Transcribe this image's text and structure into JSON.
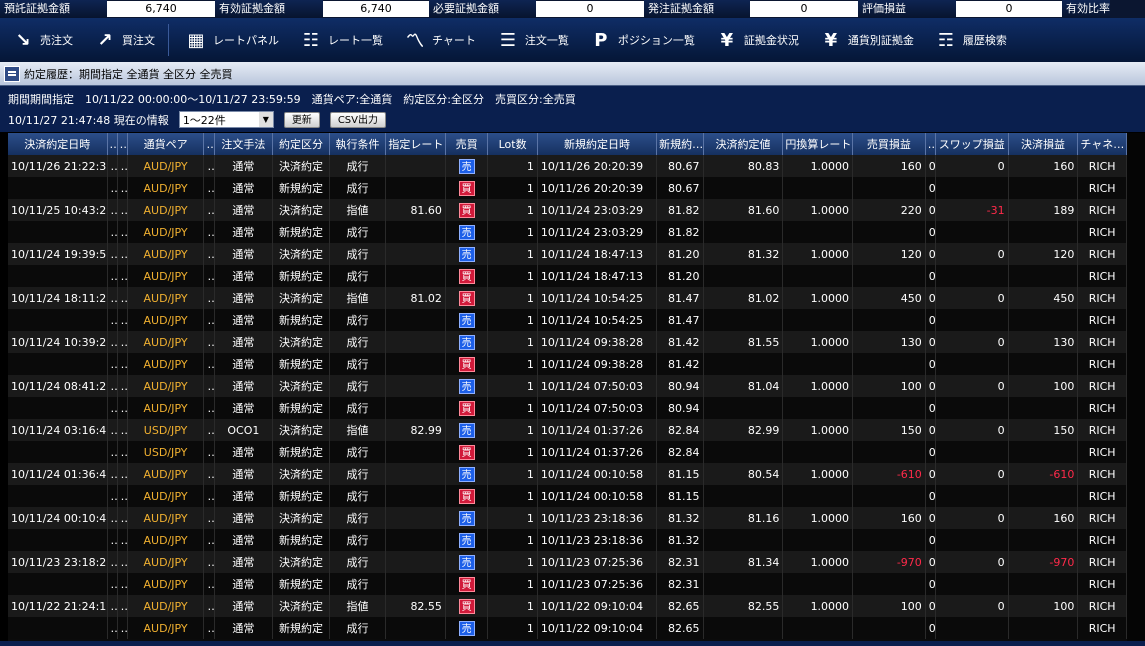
{
  "summary": [
    {
      "label": "預託証拠金額",
      "value": "6,740"
    },
    {
      "label": "有効証拠金額",
      "value": "6,740"
    },
    {
      "label": "必要証拠金額",
      "value": "0"
    },
    {
      "label": "発注証拠金額",
      "value": "0"
    },
    {
      "label": "評価損益",
      "value": "0"
    },
    {
      "label": "有効比率",
      "value": ""
    }
  ],
  "toolbar": [
    {
      "label": "売注文",
      "icon": "arrow-down-right-icon"
    },
    {
      "label": "買注文",
      "icon": "arrow-up-right-icon"
    },
    {
      "label": "レートパネル",
      "icon": "rate-panel-icon"
    },
    {
      "label": "レート一覧",
      "icon": "rate-list-icon"
    },
    {
      "label": "チャート",
      "icon": "chart-icon"
    },
    {
      "label": "注文一覧",
      "icon": "order-list-icon"
    },
    {
      "label": "ポジション一覧",
      "icon": "position-icon"
    },
    {
      "label": "証拠金状況",
      "icon": "yen-icon"
    },
    {
      "label": "通貨別証拠金",
      "icon": "currency-margin-icon"
    },
    {
      "label": "履歴検索",
      "icon": "history-search-icon"
    }
  ],
  "window": {
    "title": "約定履歴：期間指定 全通貨 全区分 全売買"
  },
  "filter": {
    "line1": "期間期間指定　10/11/22 00:00:00～10/11/27 23:59:59　通貨ペア:全通貨　約定区分:全区分　売買区分:全売買",
    "timestamp": "10/11/27 21:47:48 現在の情報",
    "range": "1～22件",
    "refresh_label": "更新",
    "csv_label": "CSV出力"
  },
  "table": {
    "headers": [
      "決済約定日時",
      "…",
      "…",
      "通貨ペア",
      "…",
      "注文手法",
      "約定区分",
      "執行条件",
      "指定レート",
      "売買",
      "Lot数",
      "新規約定日時",
      "新規約…",
      "決済約定値",
      "円換算レート",
      "売買損益",
      "…",
      "スワップ損益",
      "決済損益",
      "チャネ…"
    ],
    "rows": [
      [
        "10/11/26 21:22:3…",
        "…",
        "…",
        "AUD/JPY",
        "…",
        "通常",
        "決済約定",
        "成行",
        "",
        "売",
        "1",
        "10/11/26 20:20:39",
        "80.67",
        "80.83",
        "1.0000",
        "160",
        "0",
        "0",
        "160",
        "RICH"
      ],
      [
        "",
        "…",
        "…",
        "AUD/JPY",
        "…",
        "通常",
        "新規約定",
        "成行",
        "",
        "買",
        "1",
        "10/11/26 20:20:39",
        "80.67",
        "",
        "",
        "",
        "0",
        "",
        "",
        "RICH"
      ],
      [
        "10/11/25 10:43:2…",
        "…",
        "…",
        "AUD/JPY",
        "…",
        "通常",
        "決済約定",
        "指値",
        "81.60",
        "買",
        "1",
        "10/11/24 23:03:29",
        "81.82",
        "81.60",
        "1.0000",
        "220",
        "0",
        "-31",
        "189",
        "RICH"
      ],
      [
        "",
        "…",
        "…",
        "AUD/JPY",
        "…",
        "通常",
        "新規約定",
        "成行",
        "",
        "売",
        "1",
        "10/11/24 23:03:29",
        "81.82",
        "",
        "",
        "",
        "0",
        "",
        "",
        "RICH"
      ],
      [
        "10/11/24 19:39:5…",
        "…",
        "…",
        "AUD/JPY",
        "…",
        "通常",
        "決済約定",
        "成行",
        "",
        "売",
        "1",
        "10/11/24 18:47:13",
        "81.20",
        "81.32",
        "1.0000",
        "120",
        "0",
        "0",
        "120",
        "RICH"
      ],
      [
        "",
        "…",
        "…",
        "AUD/JPY",
        "…",
        "通常",
        "新規約定",
        "成行",
        "",
        "買",
        "1",
        "10/11/24 18:47:13",
        "81.20",
        "",
        "",
        "",
        "0",
        "",
        "",
        "RICH"
      ],
      [
        "10/11/24 18:11:2…",
        "…",
        "…",
        "AUD/JPY",
        "…",
        "通常",
        "決済約定",
        "指値",
        "81.02",
        "買",
        "1",
        "10/11/24 10:54:25",
        "81.47",
        "81.02",
        "1.0000",
        "450",
        "0",
        "0",
        "450",
        "RICH"
      ],
      [
        "",
        "…",
        "…",
        "AUD/JPY",
        "…",
        "通常",
        "新規約定",
        "成行",
        "",
        "売",
        "1",
        "10/11/24 10:54:25",
        "81.47",
        "",
        "",
        "",
        "0",
        "",
        "",
        "RICH"
      ],
      [
        "10/11/24 10:39:2…",
        "…",
        "…",
        "AUD/JPY",
        "…",
        "通常",
        "決済約定",
        "成行",
        "",
        "売",
        "1",
        "10/11/24 09:38:28",
        "81.42",
        "81.55",
        "1.0000",
        "130",
        "0",
        "0",
        "130",
        "RICH"
      ],
      [
        "",
        "…",
        "…",
        "AUD/JPY",
        "…",
        "通常",
        "新規約定",
        "成行",
        "",
        "買",
        "1",
        "10/11/24 09:38:28",
        "81.42",
        "",
        "",
        "",
        "0",
        "",
        "",
        "RICH"
      ],
      [
        "10/11/24 08:41:2…",
        "…",
        "…",
        "AUD/JPY",
        "…",
        "通常",
        "決済約定",
        "成行",
        "",
        "売",
        "1",
        "10/11/24 07:50:03",
        "80.94",
        "81.04",
        "1.0000",
        "100",
        "0",
        "0",
        "100",
        "RICH"
      ],
      [
        "",
        "…",
        "…",
        "AUD/JPY",
        "…",
        "通常",
        "新規約定",
        "成行",
        "",
        "買",
        "1",
        "10/11/24 07:50:03",
        "80.94",
        "",
        "",
        "",
        "0",
        "",
        "",
        "RICH"
      ],
      [
        "10/11/24 03:16:4…",
        "…",
        "…",
        "USD/JPY",
        "…",
        "OCO1",
        "決済約定",
        "指値",
        "82.99",
        "売",
        "1",
        "10/11/24 01:37:26",
        "82.84",
        "82.99",
        "1.0000",
        "150",
        "0",
        "0",
        "150",
        "RICH"
      ],
      [
        "",
        "…",
        "…",
        "USD/JPY",
        "…",
        "通常",
        "新規約定",
        "成行",
        "",
        "買",
        "1",
        "10/11/24 01:37:26",
        "82.84",
        "",
        "",
        "",
        "0",
        "",
        "",
        "RICH"
      ],
      [
        "10/11/24 01:36:4…",
        "…",
        "…",
        "AUD/JPY",
        "…",
        "通常",
        "決済約定",
        "成行",
        "",
        "売",
        "1",
        "10/11/24 00:10:58",
        "81.15",
        "80.54",
        "1.0000",
        "-610",
        "0",
        "0",
        "-610",
        "RICH"
      ],
      [
        "",
        "…",
        "…",
        "AUD/JPY",
        "…",
        "通常",
        "新規約定",
        "成行",
        "",
        "買",
        "1",
        "10/11/24 00:10:58",
        "81.15",
        "",
        "",
        "",
        "0",
        "",
        "",
        "RICH"
      ],
      [
        "10/11/24 00:10:4…",
        "…",
        "…",
        "AUD/JPY",
        "…",
        "通常",
        "決済約定",
        "成行",
        "",
        "売",
        "1",
        "10/11/23 23:18:36",
        "81.32",
        "81.16",
        "1.0000",
        "160",
        "0",
        "0",
        "160",
        "RICH"
      ],
      [
        "",
        "…",
        "…",
        "AUD/JPY",
        "…",
        "通常",
        "新規約定",
        "成行",
        "",
        "売",
        "1",
        "10/11/23 23:18:36",
        "81.32",
        "",
        "",
        "",
        "0",
        "",
        "",
        "RICH"
      ],
      [
        "10/11/23 23:18:2…",
        "…",
        "…",
        "AUD/JPY",
        "…",
        "通常",
        "決済約定",
        "成行",
        "",
        "売",
        "1",
        "10/11/23 07:25:36",
        "82.31",
        "81.34",
        "1.0000",
        "-970",
        "0",
        "0",
        "-970",
        "RICH"
      ],
      [
        "",
        "…",
        "…",
        "AUD/JPY",
        "…",
        "通常",
        "新規約定",
        "成行",
        "",
        "買",
        "1",
        "10/11/23 07:25:36",
        "82.31",
        "",
        "",
        "",
        "0",
        "",
        "",
        "RICH"
      ],
      [
        "10/11/22 21:24:1…",
        "…",
        "…",
        "AUD/JPY",
        "…",
        "通常",
        "決済約定",
        "指値",
        "82.55",
        "買",
        "1",
        "10/11/22 09:10:04",
        "82.65",
        "82.55",
        "1.0000",
        "100",
        "0",
        "0",
        "100",
        "RICH"
      ],
      [
        "",
        "…",
        "…",
        "AUD/JPY",
        "…",
        "通常",
        "新規約定",
        "成行",
        "",
        "売",
        "1",
        "10/11/22 09:10:04",
        "82.65",
        "",
        "",
        "",
        "0",
        "",
        "",
        "RICH"
      ]
    ]
  },
  "colors": {
    "sell": "#1d5fe8",
    "buy": "#d11a3a",
    "pair": "#f0b030",
    "negative": "#ff2a4a",
    "header": "#15305f"
  }
}
